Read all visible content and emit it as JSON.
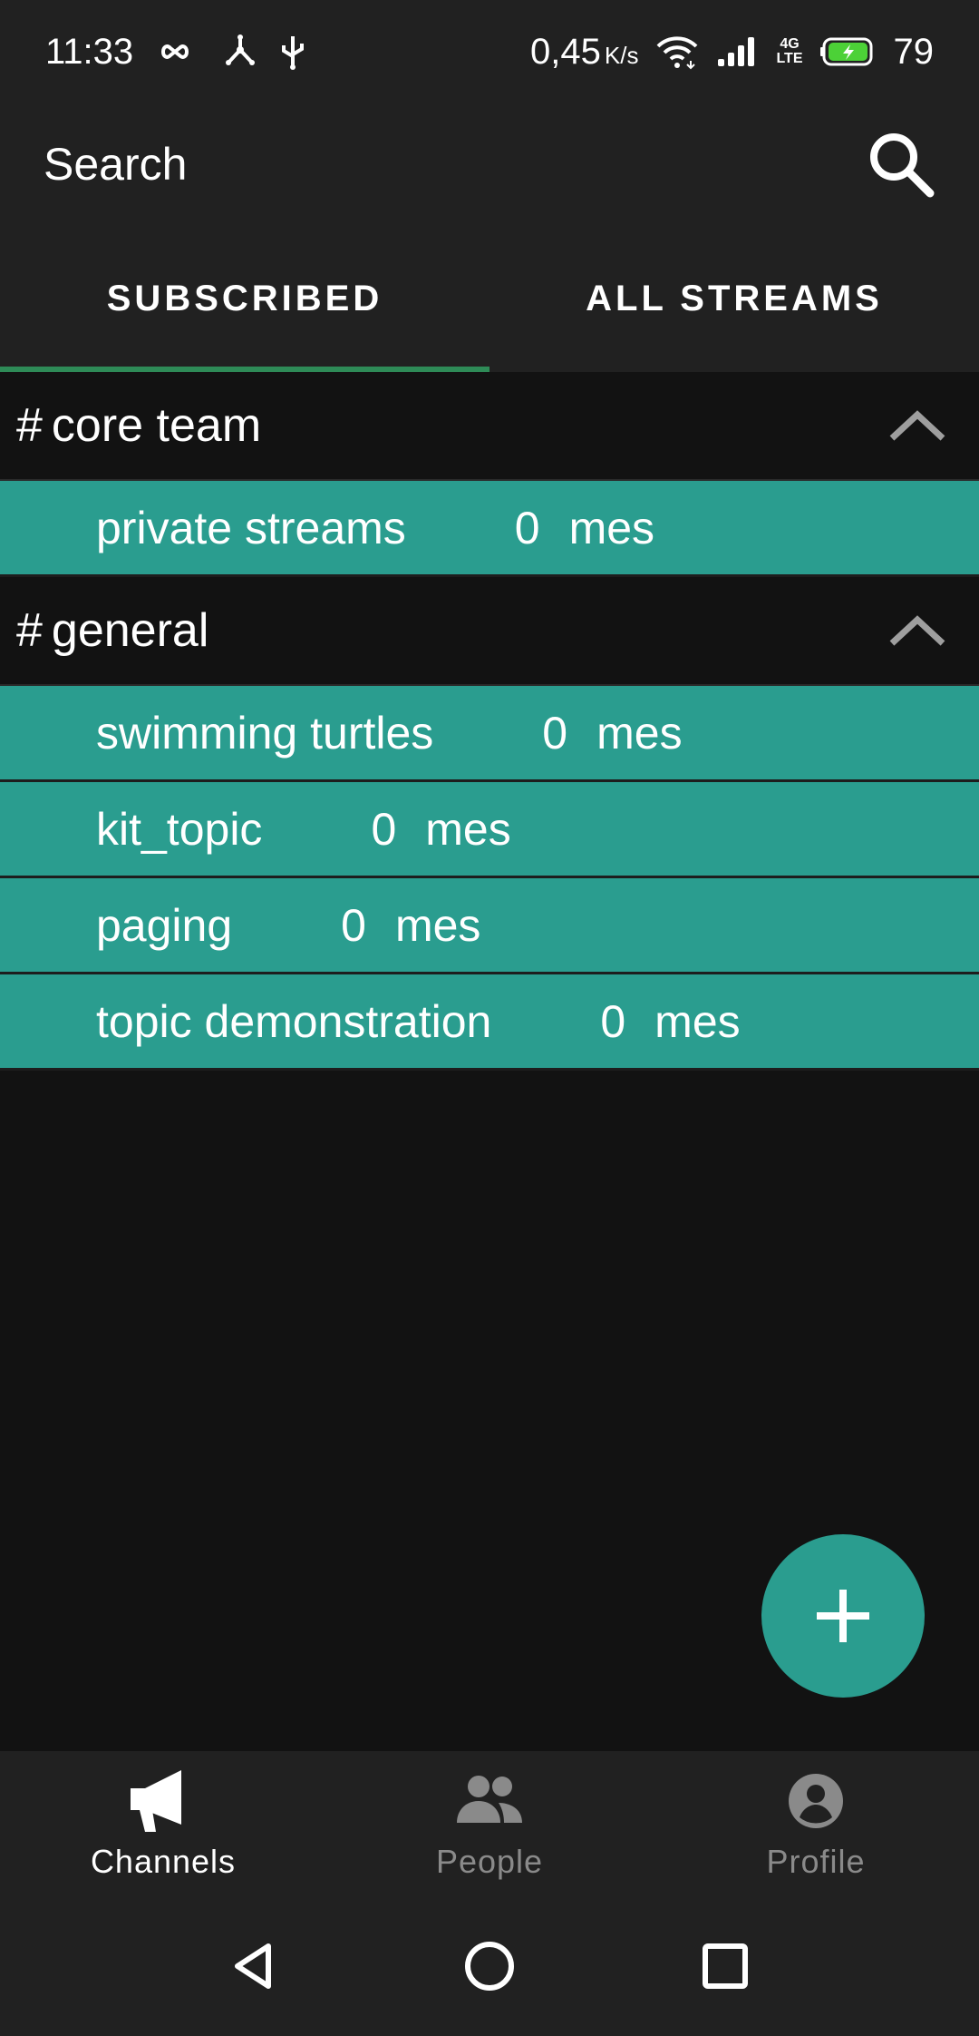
{
  "status_bar": {
    "time": "11:33",
    "speed_value": "0,45",
    "speed_unit": "K/s",
    "network_top": "4G",
    "network_bottom": "LTE",
    "battery": "79"
  },
  "search": {
    "placeholder": "Search",
    "icon": "search-icon"
  },
  "tabs": [
    {
      "label": "SUBSCRIBED",
      "active": true
    },
    {
      "label": "ALL STREAMS",
      "active": false
    }
  ],
  "streams": [
    {
      "hash": "#",
      "name": "core team",
      "topics": [
        {
          "name": "private streams",
          "count": "0",
          "unit": "mes"
        }
      ]
    },
    {
      "hash": "#",
      "name": "general",
      "topics": [
        {
          "name": "swimming turtles",
          "count": "0",
          "unit": "mes"
        },
        {
          "name": "kit_topic",
          "count": "0",
          "unit": "mes"
        },
        {
          "name": "paging",
          "count": "0",
          "unit": "mes"
        },
        {
          "name": "topic demonstration",
          "count": "0",
          "unit": "mes"
        }
      ]
    }
  ],
  "fab": {
    "icon": "plus-icon"
  },
  "bottom_nav": [
    {
      "label": "Channels",
      "icon": "megaphone-icon",
      "active": true
    },
    {
      "label": "People",
      "icon": "people-icon",
      "active": false
    },
    {
      "label": "Profile",
      "icon": "profile-icon",
      "active": false
    }
  ],
  "colors": {
    "accent": "#2a9d8f",
    "tab_indicator": "#2e8b57",
    "bar_background": "#212121",
    "background": "#121212"
  }
}
